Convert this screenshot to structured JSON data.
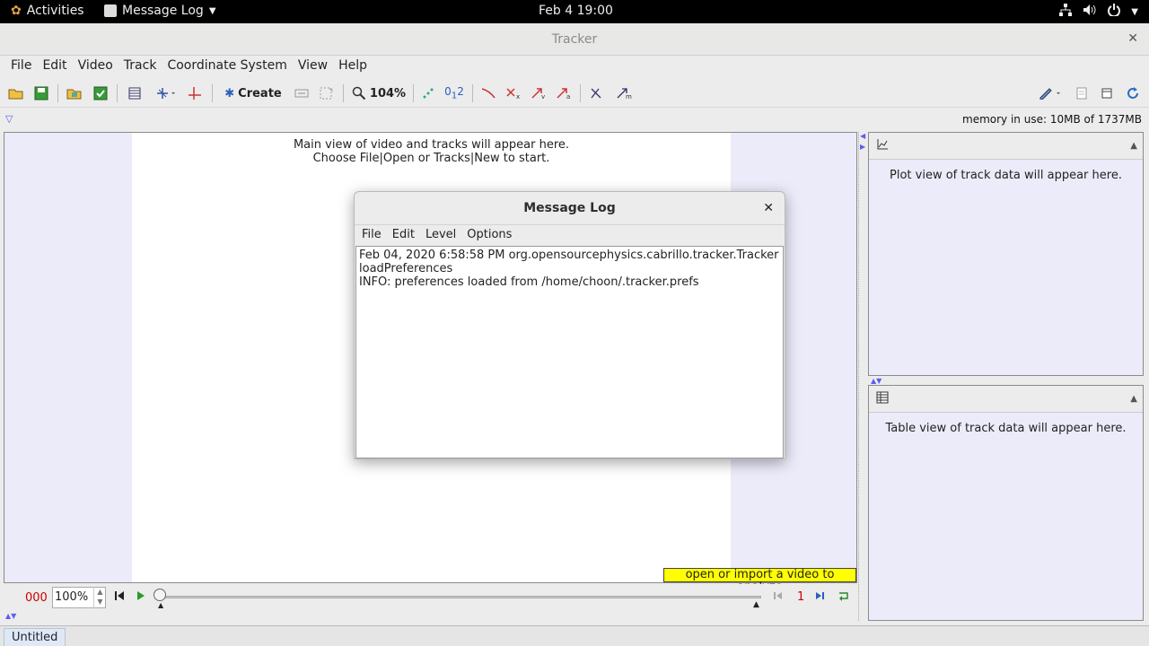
{
  "topbar": {
    "activities": "Activities",
    "app_menu": "Message Log",
    "clock": "Feb 4  19:00"
  },
  "window": {
    "title": "Tracker"
  },
  "menubar": {
    "items": [
      "File",
      "Edit",
      "Video",
      "Track",
      "Coordinate System",
      "View",
      "Help"
    ]
  },
  "toolbar": {
    "create_label": "Create",
    "zoom_label": "104%"
  },
  "status": {
    "memory": "memory in use: 10MB of 1737MB"
  },
  "main": {
    "line1": "Main view of video and tracks will appear here.",
    "line2": "Choose File|Open or Tracks|New to start.",
    "hint": "open or import a video to analyze"
  },
  "player": {
    "frame": "000",
    "rate": "100%",
    "step": "1"
  },
  "plot": {
    "message": "Plot view of track data will appear here."
  },
  "table": {
    "message": "Table view of track data will appear here."
  },
  "dialog": {
    "title": "Message Log",
    "menu": [
      "File",
      "Edit",
      "Level",
      "Options"
    ],
    "log": [
      "Feb 04, 2020 6:58:58 PM org.opensourcephysics.cabrillo.tracker.Tracker",
      "loadPreferences",
      "INFO: preferences loaded from /home/choon/.tracker.prefs"
    ]
  },
  "tabs": {
    "active": "Untitled"
  },
  "colors": {
    "hint_bg": "#ffff00",
    "pane_bg": "#ebebfa",
    "frame_red": "#cc0000",
    "accent_blue": "#5d5df2"
  }
}
